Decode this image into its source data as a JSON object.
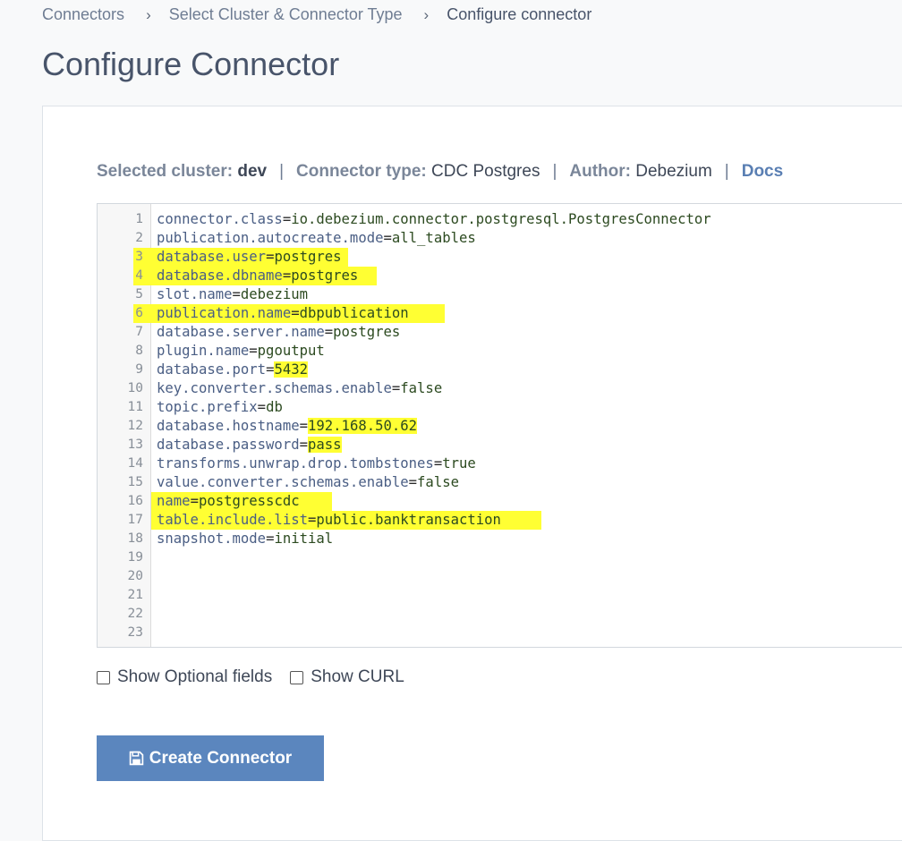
{
  "breadcrumb": {
    "items": [
      "Connectors",
      "Select Cluster & Connector Type",
      "Configure connector"
    ],
    "separator": "›"
  },
  "page_title": "Configure Connector",
  "meta": {
    "cluster_label": "Selected cluster:",
    "cluster_value": "dev",
    "type_label": "Connector type:",
    "type_value": "CDC Postgres",
    "author_label": "Author:",
    "author_value": "Debezium",
    "docs_link": "Docs",
    "pipe": "|"
  },
  "editor": {
    "lines": [
      {
        "n": "1",
        "key": "connector.class",
        "value": "io.debezium.connector.postgresql.PostgresConnector"
      },
      {
        "n": "2",
        "key": "publication.autocreate.mode",
        "value": "all_tables"
      },
      {
        "n": "3",
        "key": "database.user",
        "value": "postgres"
      },
      {
        "n": "4",
        "key": "database.dbname",
        "value": "postgres"
      },
      {
        "n": "5",
        "key": "slot.name",
        "value": "debezium"
      },
      {
        "n": "6",
        "key": "publication.name",
        "value": "dbpublication"
      },
      {
        "n": "7",
        "key": "database.server.name",
        "value": "postgres"
      },
      {
        "n": "8",
        "key": "plugin.name",
        "value": "pgoutput"
      },
      {
        "n": "9",
        "key": "database.port",
        "value": "5432"
      },
      {
        "n": "10",
        "key": "key.converter.schemas.enable",
        "value": "false"
      },
      {
        "n": "11",
        "key": "topic.prefix",
        "value": "db"
      },
      {
        "n": "12",
        "key": "database.hostname",
        "value": "192.168.50.62"
      },
      {
        "n": "13",
        "key": "database.password",
        "value": "pass"
      },
      {
        "n": "14",
        "key": "transforms.unwrap.drop.tombstones",
        "value": "true"
      },
      {
        "n": "15",
        "key": "value.converter.schemas.enable",
        "value": "false"
      },
      {
        "n": "16",
        "key": "name",
        "value": "postgresscdc"
      },
      {
        "n": "17",
        "key": "table.include.list",
        "value": "public.banktransaction"
      },
      {
        "n": "18",
        "key": "snapshot.mode",
        "value": "initial"
      },
      {
        "n": "19",
        "key": "",
        "value": ""
      },
      {
        "n": "20",
        "key": "",
        "value": ""
      },
      {
        "n": "21",
        "key": "",
        "value": ""
      },
      {
        "n": "22",
        "key": "",
        "value": ""
      },
      {
        "n": "23",
        "key": "",
        "value": ""
      }
    ],
    "highlight_color": "#ffff33"
  },
  "options": {
    "show_optional": "Show Optional fields",
    "show_curl": "Show CURL"
  },
  "create_button": {
    "label": "Create Connector",
    "icon": "save-icon",
    "color": "#5b86be"
  }
}
